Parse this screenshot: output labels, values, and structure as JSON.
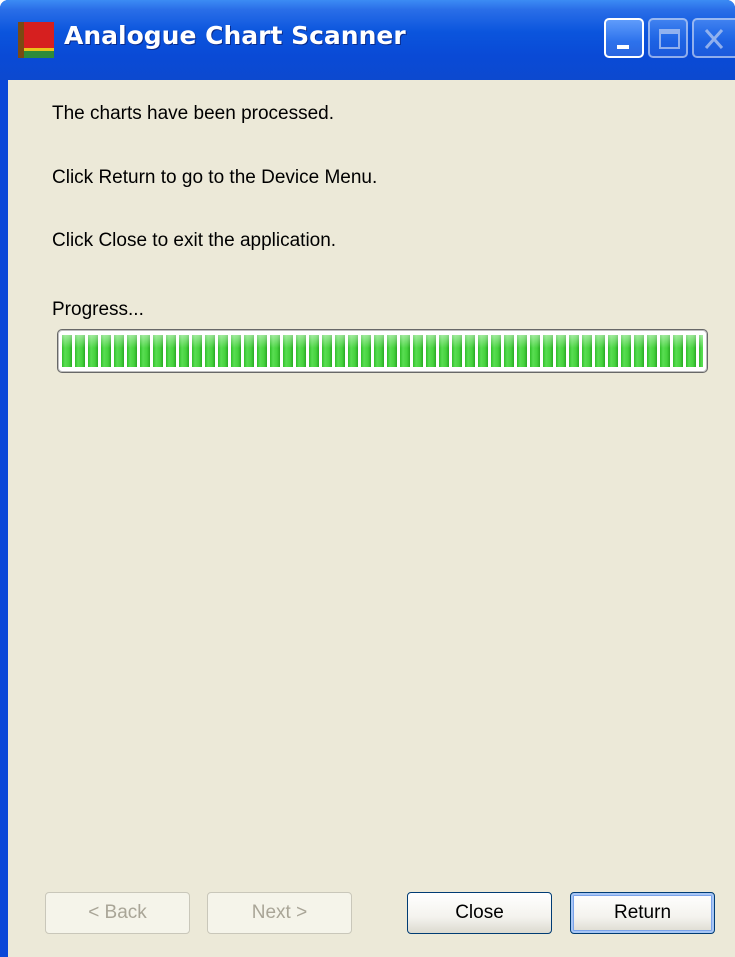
{
  "window": {
    "title": "Analogue Chart Scanner",
    "controls": [
      "minimize-icon",
      "maximize-icon",
      "close-icon"
    ]
  },
  "messages": {
    "processed": "The charts have been processed.",
    "return_hint": "Click Return to go to the Device Menu.",
    "close_hint": "Click Close to exit the application."
  },
  "progress": {
    "label": "Progress...",
    "fraction": 1.0
  },
  "buttons": {
    "back": "< Back",
    "next": "Next >",
    "close": "Close",
    "return": "Return"
  },
  "colors": {
    "titlebar": "#0a4ad6",
    "client_background": "#ece9d8",
    "progress_green": "#46d23e"
  }
}
